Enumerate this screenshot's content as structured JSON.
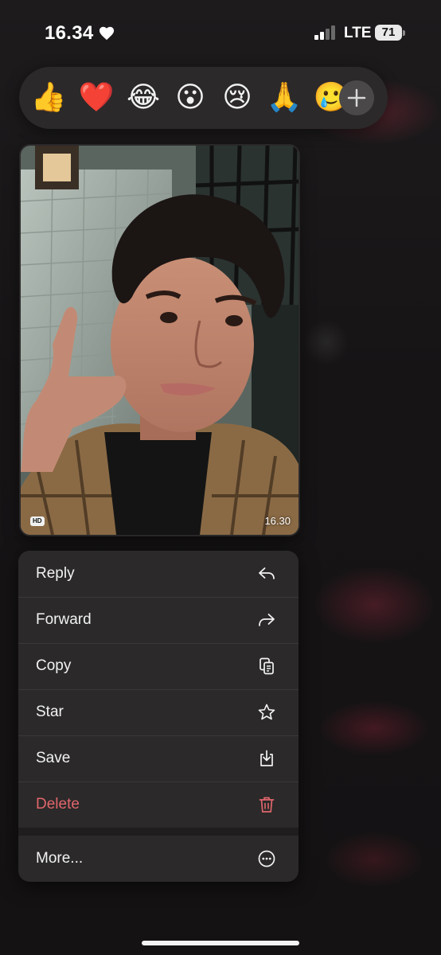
{
  "status_bar": {
    "time": "16.34",
    "network": "LTE",
    "battery": "71"
  },
  "reactions": {
    "items": [
      "👍",
      "❤️",
      "😂",
      "😮",
      "😢",
      "🙏",
      "🥲"
    ],
    "more_icon": "plus-icon"
  },
  "photo": {
    "quality_badge": "HD",
    "timestamp": "16.30"
  },
  "menu": {
    "reply": "Reply",
    "forward": "Forward",
    "copy": "Copy",
    "star": "Star",
    "save": "Save",
    "delete": "Delete",
    "more": "More..."
  },
  "colors": {
    "danger": "#e0666c",
    "menu_bg": "#2b2929",
    "reaction_bg": "#2b292a"
  }
}
